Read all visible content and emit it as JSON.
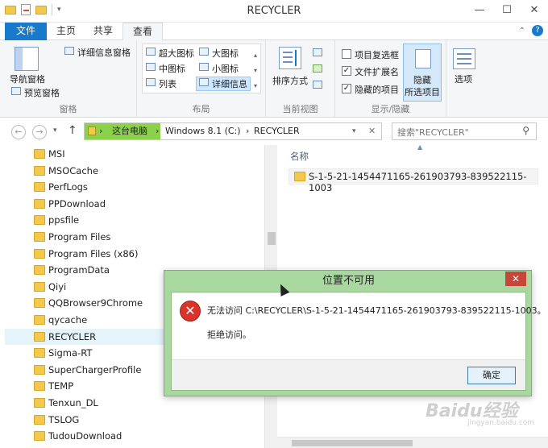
{
  "window": {
    "title": "RECYCLER",
    "min": "—",
    "max": "☐",
    "close": "✕"
  },
  "ribbon_tabs": {
    "file": "文件",
    "home": "主页",
    "share": "共享",
    "view": "查看",
    "help": "?"
  },
  "ribbon": {
    "panes": {
      "nav_pane": "导航窗格",
      "preview_pane": "预览窗格",
      "details_pane": "详细信息窗格",
      "label": "窗格"
    },
    "layout": {
      "xl_icons": "超大图标",
      "large_icons": "大图标",
      "medium_icons": "中图标",
      "small_icons": "小图标",
      "list": "列表",
      "details": "详细信息",
      "label": "布局"
    },
    "current_view": {
      "sort_by": "排序方式",
      "label": "当前视图"
    },
    "show_hide": {
      "item_checkboxes": "项目复选框",
      "file_extensions": "文件扩展名",
      "hidden_items": "隐藏的项目",
      "hide_line1": "隐藏",
      "hide_line2": "所选项目",
      "label": "显示/隐藏"
    },
    "options": "选项",
    "checked": "✓"
  },
  "address": {
    "seg1": "这台电脑",
    "seg2": "Windows 8.1 (C:)",
    "seg3": "RECYCLER",
    "sep": "›",
    "search_placeholder": "搜索\"RECYCLER\""
  },
  "nav": {
    "back": "←",
    "forward": "→",
    "up": "↑",
    "dropdown": "▾"
  },
  "tree_items": [
    "MSI",
    "MSOCache",
    "PerfLogs",
    "PPDownload",
    "ppsfile",
    "Program Files",
    "Program Files (x86)",
    "ProgramData",
    "Qiyi",
    "QQBrowser9Chrome",
    "qycache",
    "RECYCLER",
    "Sigma-RT",
    "SuperChargerProfile",
    "TEMP",
    "Tenxun_DL",
    "TSLOG",
    "TudouDownload"
  ],
  "content": {
    "column_name": "名称",
    "file_name": "S-1-5-21-1454471165-261903793-839522115-1003"
  },
  "dialog": {
    "title": "位置不可用",
    "message": "无法访问 C:\\RECYCLER\\S-1-5-21-1454471165-261903793-839522115-1003。",
    "reason": "拒绝访问。",
    "ok_label": "确定",
    "error_glyph": "✕"
  },
  "watermark": {
    "brand": "Baidu经验",
    "url": "jingyan.baidu.com"
  }
}
